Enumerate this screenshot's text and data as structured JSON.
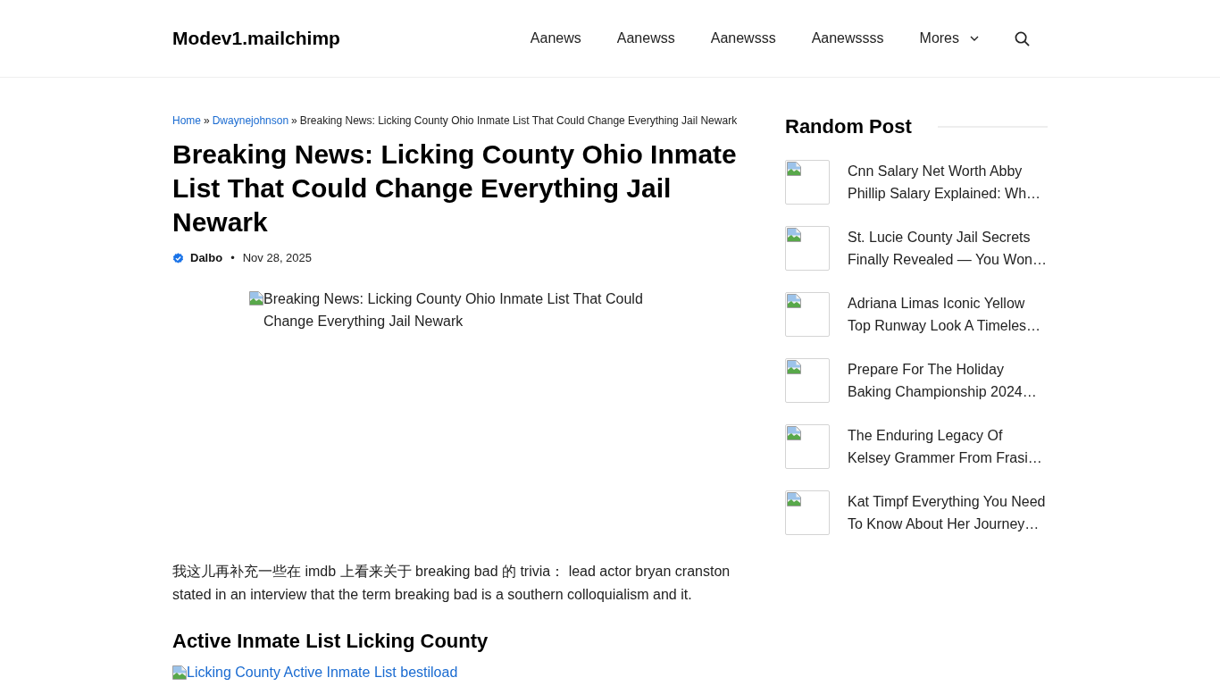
{
  "header": {
    "logo": "Modev1.mailchimp",
    "nav": [
      {
        "label": "Aanews",
        "kind": "link"
      },
      {
        "label": "Aanewss",
        "kind": "link"
      },
      {
        "label": "Aanewsss",
        "kind": "link"
      },
      {
        "label": "Aanewssss",
        "kind": "link"
      },
      {
        "label": "Mores",
        "kind": "dropdown"
      },
      {
        "kind": "search"
      }
    ]
  },
  "breadcrumb": [
    {
      "label": "Home",
      "kind": "link"
    },
    {
      "label": "»",
      "kind": "separator"
    },
    {
      "label": "Dwaynejohnson",
      "kind": "link"
    },
    {
      "label": "»",
      "kind": "separator"
    },
    {
      "label": "Breaking News: Licking County Ohio Inmate List That Could Change Everything Jail Newark",
      "kind": "current"
    }
  ],
  "article": {
    "title": "Breaking News: Licking County Ohio Inmate List That Could Change Everything Jail Newark",
    "author": {
      "name": "Dalbo",
      "verified": true
    },
    "meta_separator": "•",
    "date": "Nov 28, 2025",
    "featured_image": {
      "alt": "Breaking News: Licking County Ohio Inmate List That Could Change Everything Jail Newark"
    },
    "body": [
      {
        "kind": "paragraph",
        "text": "我这儿再补充一些在 imdb 上看来关于 breaking bad 的 trivia： lead actor bryan cranston stated in an interview that the term breaking bad is a southern colloquialism and it."
      },
      {
        "kind": "heading",
        "text": "Active Inmate List Licking County"
      },
      {
        "kind": "image_link",
        "text": "Licking County Active Inmate List bestiload"
      }
    ]
  },
  "sidebar": {
    "title": "Random Post",
    "posts": [
      {
        "title": "Cnn Salary Net Worth Abby Phillip Salary Explained: Wh…"
      },
      {
        "title": "St. Lucie County Jail Secrets Finally Revealed — You Won…"
      },
      {
        "title": "Adriana Limas Iconic Yellow Top Runway Look A Timeles…"
      },
      {
        "title": "Prepare For The Holiday Baking Championship 2024…"
      },
      {
        "title": "The Enduring Legacy Of Kelsey Grammer From Frasi…"
      },
      {
        "title": "Kat Timpf Everything You Need To Know About Her Journey…"
      }
    ]
  }
}
